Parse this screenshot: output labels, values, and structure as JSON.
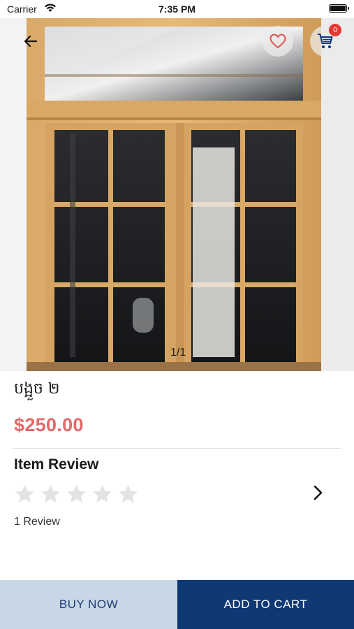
{
  "status": {
    "carrier": "Carrier",
    "time": "7:35 PM"
  },
  "product": {
    "image_label": "wooden-window-product-photo",
    "pager": "1/1",
    "name": "បង្អួច ២",
    "price": "$250.00"
  },
  "cart": {
    "badge_count": "0"
  },
  "reviews": {
    "heading": "Item Review",
    "rating": 0,
    "max_rating": 5,
    "count_text": "1 Review"
  },
  "actions": {
    "buy_now": "BUY NOW",
    "add_to_cart": "ADD TO CART"
  },
  "colors": {
    "price": "#e26a6a",
    "buy_bg": "#c9d6e6",
    "cart_bg": "#0f3875",
    "badge": "#e53935",
    "star_empty": "#e3e3e3"
  }
}
